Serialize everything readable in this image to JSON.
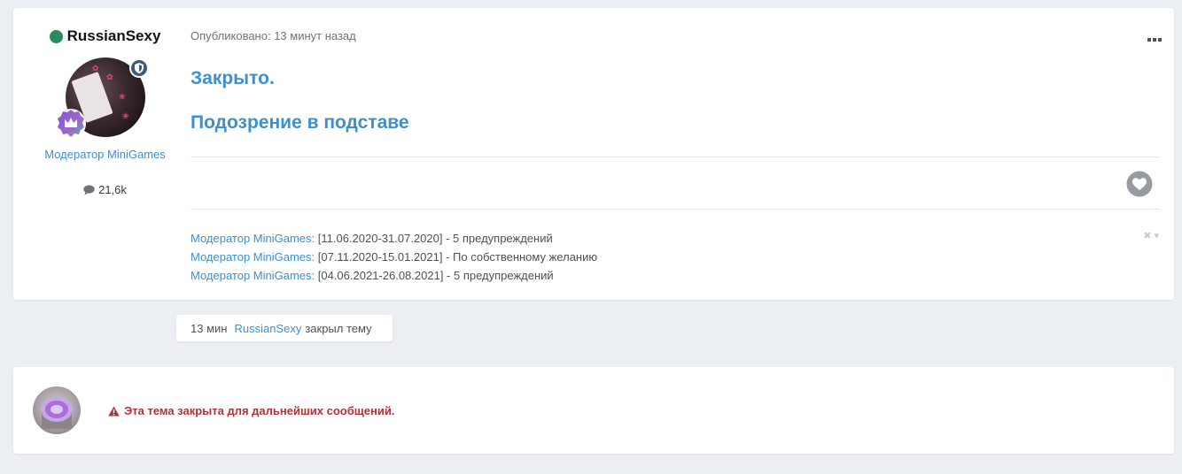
{
  "post": {
    "author": {
      "name": "RussianSexy",
      "online": true,
      "title": "Модератор MiniGames",
      "post_count": "21,6k"
    },
    "meta": "Опубликовано: 13 минут назад",
    "content": {
      "line1": "Закрыто.",
      "line2": "Подозрение в подставе"
    },
    "signature": [
      {
        "label": "Модератор MiniGames:",
        "text": " [11.06.2020-31.07.2020] - 5 предупреждений"
      },
      {
        "label": "Модератор MiniGames:",
        "text": " [07.11.2020-15.01.2021] - По собственному желанию"
      },
      {
        "label": "Модератор MiniGames:",
        "text": " [04.06.2021-26.08.2021] - 5 предупреждений"
      }
    ]
  },
  "event": {
    "time": "13 мин",
    "user": "RussianSexy",
    "action": "закрыл тему"
  },
  "closed_notice": {
    "message": "Эта тема закрыта для дальнейших сообщений."
  },
  "colors": {
    "accent": "#3d8fd0",
    "online": "#2a8a5f",
    "warning": "#b13235",
    "background": "#ebeef2"
  }
}
